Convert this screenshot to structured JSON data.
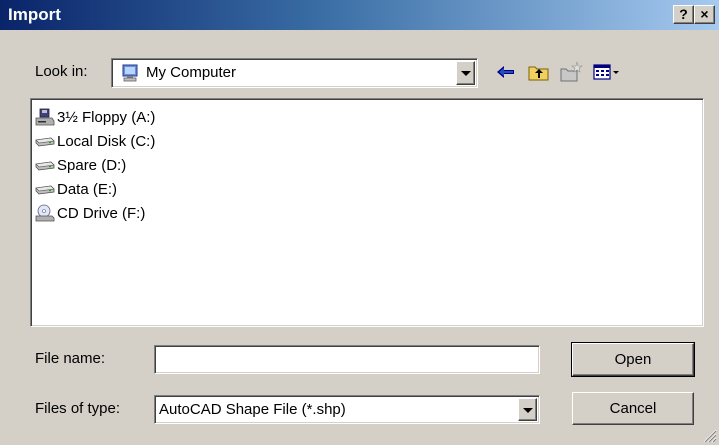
{
  "window": {
    "title": "Import",
    "help_label": "?",
    "close_label": "×"
  },
  "look_in": {
    "label": "Look in:",
    "value": "My Computer",
    "icon": "my-computer-icon"
  },
  "toolbar": {
    "icons": [
      "back-arrow-icon",
      "up-one-level-icon",
      "create-new-folder-icon",
      "view-menu-icon"
    ]
  },
  "drives": [
    {
      "label": "3½ Floppy (A:)",
      "icon": "floppy-drive-icon"
    },
    {
      "label": "Local Disk (C:)",
      "icon": "hard-disk-icon"
    },
    {
      "label": "Spare (D:)",
      "icon": "hard-disk-icon"
    },
    {
      "label": "Data (E:)",
      "icon": "hard-disk-icon"
    },
    {
      "label": "CD Drive (F:)",
      "icon": "cd-drive-icon"
    }
  ],
  "file_name": {
    "label": "File name:",
    "value": ""
  },
  "file_type": {
    "label": "Files of type:",
    "value": "AutoCAD Shape File (*.shp)"
  },
  "buttons": {
    "open": "Open",
    "cancel": "Cancel"
  },
  "colors": {
    "title_bar_start": "#0a246a",
    "title_bar_end": "#a6caf0",
    "dialog_face": "#d4d0c8"
  }
}
